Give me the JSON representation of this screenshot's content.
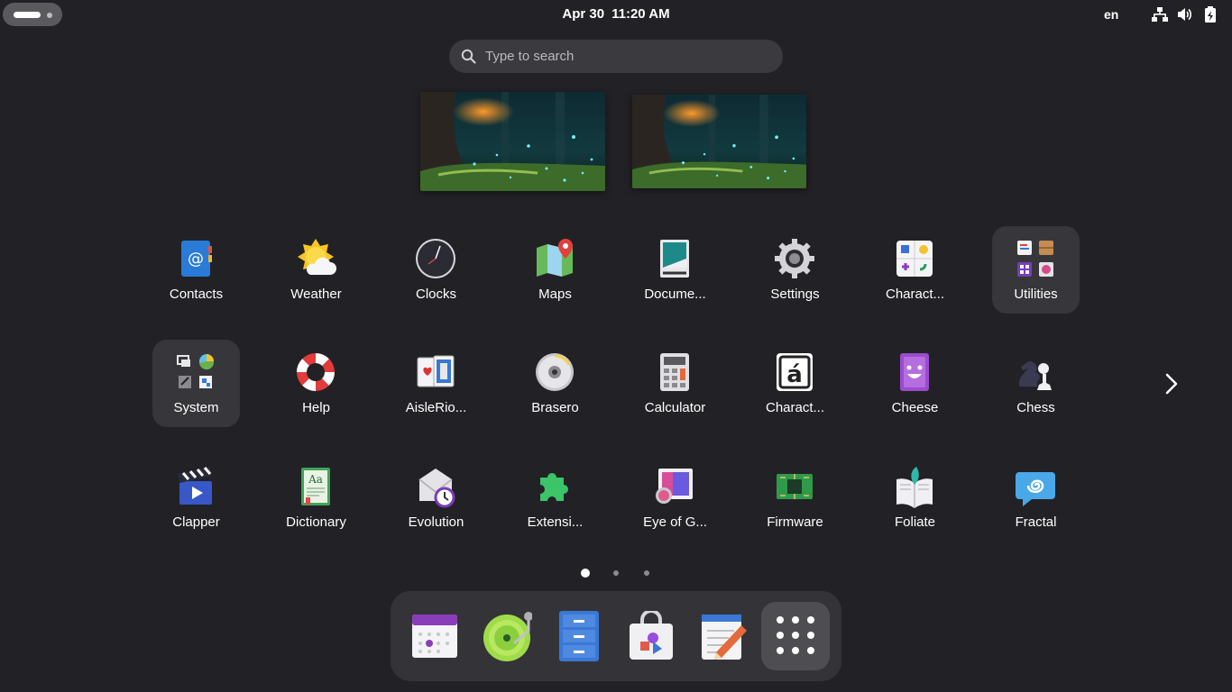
{
  "topbar": {
    "date": "Apr 30",
    "time": "11:20 AM",
    "language": "en"
  },
  "search": {
    "placeholder": "Type to search"
  },
  "apps": {
    "row1": [
      "Contacts",
      "Weather",
      "Clocks",
      "Maps",
      "Docume...",
      "Settings",
      "Charact...",
      "Utilities"
    ],
    "row2": [
      "System",
      "Help",
      "AisleRio...",
      "Brasero",
      "Calculator",
      "Charact...",
      "Cheese",
      "Chess"
    ],
    "row3": [
      "Clapper",
      "Dictionary",
      "Evolution",
      "Extensi...",
      "Eye of G...",
      "Firmware",
      "Foliate",
      "Fractal"
    ]
  },
  "pages": {
    "total": 3,
    "current": 1
  },
  "dash": [
    "calendar-icon",
    "music-player-icon",
    "files-icon",
    "software-icon",
    "text-editor-icon",
    "show-apps-icon"
  ],
  "colors": {
    "background": "#222226",
    "panel": "#343438",
    "folder": "#37373b"
  }
}
